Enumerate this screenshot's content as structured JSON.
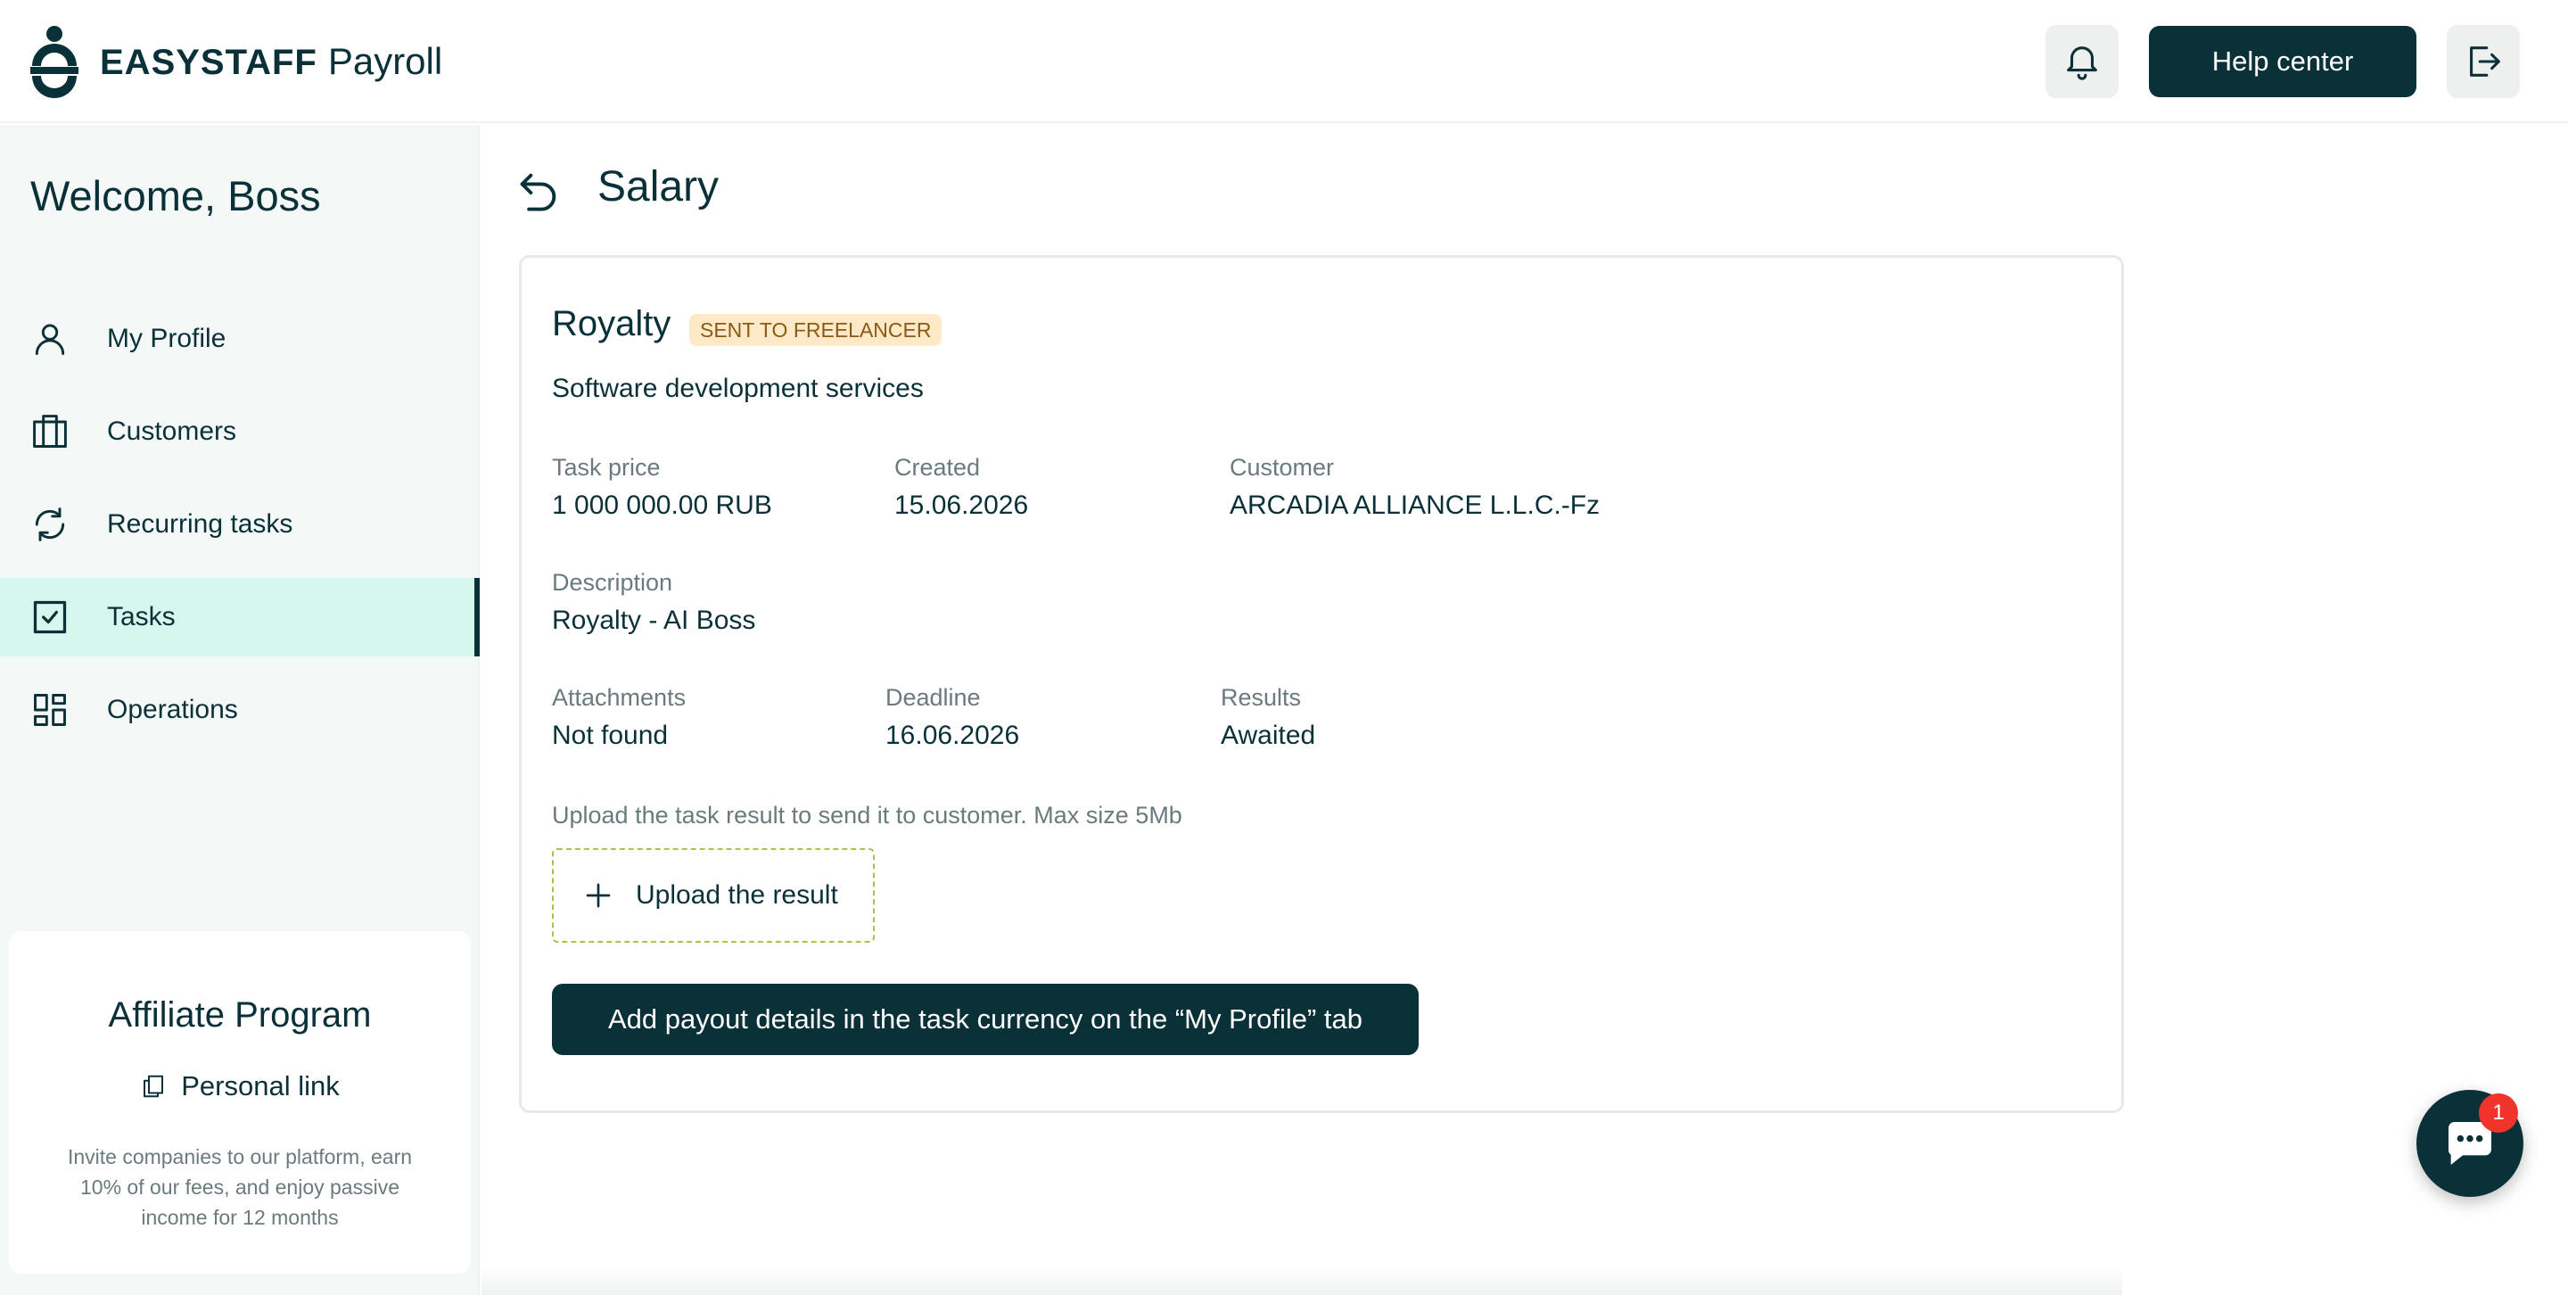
{
  "header": {
    "brand": "EASYSTAFF",
    "product": "Payroll",
    "help_label": "Help center"
  },
  "sidebar": {
    "welcome": "Welcome, Boss",
    "items": [
      {
        "label": "My Profile",
        "icon": "user-icon"
      },
      {
        "label": "Customers",
        "icon": "briefcase-icon"
      },
      {
        "label": "Recurring tasks",
        "icon": "refresh-icon"
      },
      {
        "label": "Tasks",
        "icon": "checkbox-icon",
        "active": true
      },
      {
        "label": "Operations",
        "icon": "dashboard-icon"
      }
    ],
    "affiliate": {
      "title": "Affiliate Program",
      "link_label": "Personal link",
      "description": "Invite companies to our platform, earn 10% of our fees, and enjoy passive income for 12 months"
    }
  },
  "main": {
    "page_title": "Salary",
    "task": {
      "title": "Royalty",
      "status": "SENT TO FREELANCER",
      "subtitle": "Software development services",
      "fields": {
        "task_price": {
          "label": "Task price",
          "value": "1 000 000.00 RUB"
        },
        "created": {
          "label": "Created",
          "value": "15.06.2026"
        },
        "customer": {
          "label": "Customer",
          "value": "ARCADIA ALLIANCE L.L.C.-Fz"
        },
        "description": {
          "label": "Description",
          "value": "Royalty - AI Boss"
        },
        "attachments": {
          "label": "Attachments",
          "value": "Not found"
        },
        "deadline": {
          "label": "Deadline",
          "value": "16.06.2026"
        },
        "results": {
          "label": "Results",
          "value": "Awaited"
        }
      },
      "upload_hint": "Upload the task result to send it to customer. Max size 5Mb",
      "upload_label": "Upload the result",
      "payout_label": "Add payout details in the task currency on the “My Profile” tab"
    }
  },
  "chat": {
    "badge_count": "1"
  },
  "colors": {
    "primary": "#0b3138",
    "active_bg": "#d5f7ee",
    "badge_bg": "#fde9c8",
    "badge_text": "#8b5a13",
    "notification": "#f0332b",
    "dashed_border": "#a9c24e"
  }
}
